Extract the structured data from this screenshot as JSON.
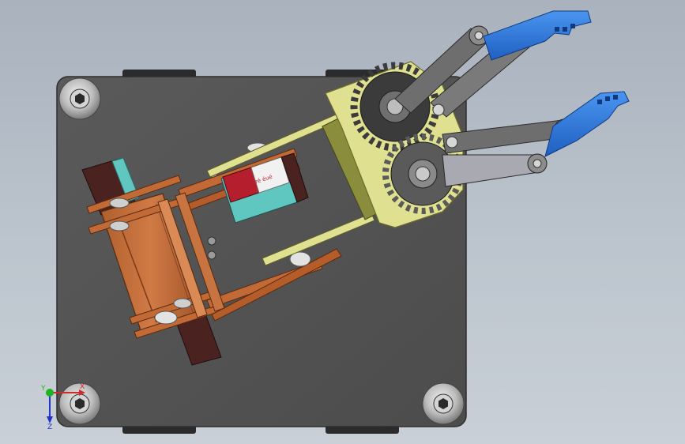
{
  "viewport": {
    "background_top": "#a9b2bd",
    "background_bottom": "#c9d0d7"
  },
  "model": {
    "base_plate_color": "#545454",
    "bracket_color": "#c26a35",
    "gripper_mount_color": "#dfe090",
    "gear_color": "#3b3b3b",
    "link_color": "#6e6e6e",
    "finger_color": "#2f7be0",
    "servo_teal": "#5fc6c0",
    "servo_red": "#b51e2c",
    "motor_dark": "#4a2320"
  },
  "servo_label": {
    "text": "Iré éué"
  },
  "triad": {
    "x_label": "X",
    "y_label": "Y",
    "z_label": "Z",
    "x_color": "#d12a2a",
    "y_color": "#1db423",
    "z_color": "#2231c9"
  }
}
